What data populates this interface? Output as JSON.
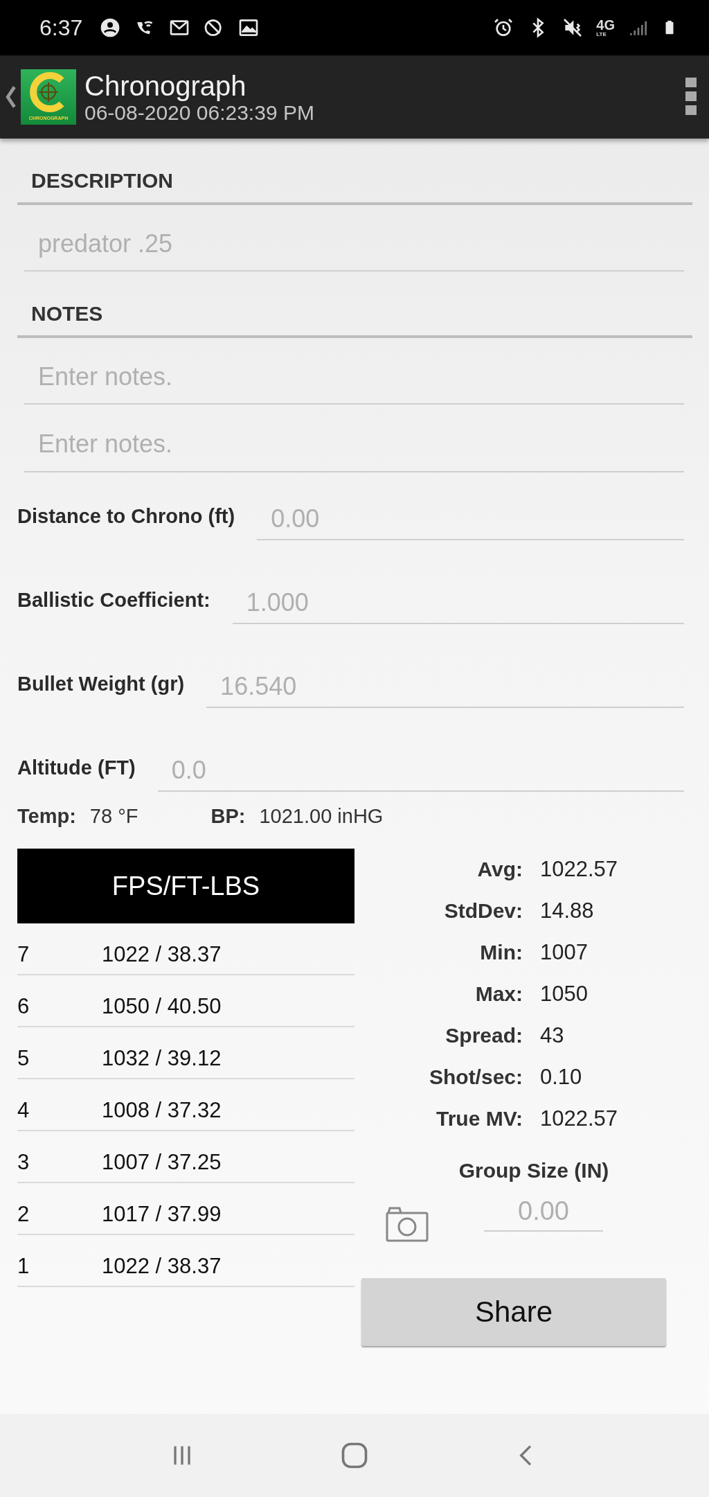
{
  "status_bar": {
    "time": "6:37",
    "network": "4G",
    "network_sub": "LTE"
  },
  "app_bar": {
    "logo_text": "CHRONOGRAPH",
    "title": "Chronograph",
    "subtitle": "06-08-2020 06:23:39 PM"
  },
  "description": {
    "header": "DESCRIPTION",
    "placeholder": "predator .25"
  },
  "notes": {
    "header": "NOTES",
    "fields": [
      {
        "placeholder": "Enter notes."
      },
      {
        "placeholder": "Enter notes."
      }
    ]
  },
  "fields": [
    {
      "label": "Distance to Chrono (ft)",
      "placeholder": "0.00"
    },
    {
      "label": "Ballistic Coefficient:",
      "placeholder": "1.000"
    },
    {
      "label": "Bullet Weight (gr)",
      "placeholder": "16.540"
    },
    {
      "label": "Altitude (FT)",
      "placeholder": "0.0"
    }
  ],
  "conditions": [
    {
      "label": "Temp:",
      "value": "78 °F"
    },
    {
      "label": "BP:",
      "value": "1021.00 inHG"
    }
  ],
  "shots": {
    "header": "FPS/FT-LBS",
    "rows": [
      {
        "number": "7",
        "value": "1022 / 38.37"
      },
      {
        "number": "6",
        "value": "1050 / 40.50"
      },
      {
        "number": "5",
        "value": "1032 / 39.12"
      },
      {
        "number": "4",
        "value": "1008 / 37.32"
      },
      {
        "number": "3",
        "value": "1007 / 37.25"
      },
      {
        "number": "2",
        "value": "1017 / 37.99"
      },
      {
        "number": "1",
        "value": "1022 / 38.37"
      }
    ]
  },
  "stats": [
    {
      "label": "Avg:",
      "value": "1022.57"
    },
    {
      "label": "StdDev:",
      "value": "14.88"
    },
    {
      "label": "Min:",
      "value": "1007"
    },
    {
      "label": "Max:",
      "value": "1050"
    },
    {
      "label": "Spread:",
      "value": "43"
    },
    {
      "label": "Shot/sec:",
      "value": "0.10"
    },
    {
      "label": "True MV:",
      "value": "1022.57"
    }
  ],
  "group_size": {
    "label": "Group Size (IN)",
    "placeholder": "0.00"
  },
  "share_button": "Share"
}
